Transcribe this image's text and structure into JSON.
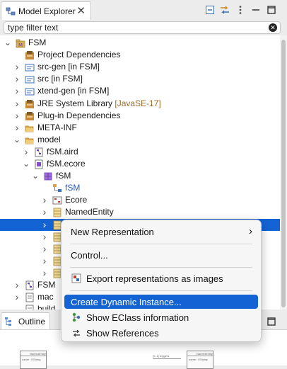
{
  "view": {
    "title": "Model Explorer",
    "close_glyph": "✕",
    "toolbar_icons": [
      "collapse-all-icon",
      "link-with-editor-icon",
      "view-menu-icon",
      "minimize-icon",
      "maximize-icon"
    ]
  },
  "filter": {
    "placeholder": "type filter text",
    "value": "type filter text"
  },
  "tree": [
    {
      "label": "FSM",
      "icon": "project-icon",
      "twisty": "expanded"
    },
    {
      "label": "Project Dependencies",
      "icon": "jar-library-icon",
      "twisty": "none"
    },
    {
      "label": "src-gen [in FSM]",
      "icon": "source-folder-icon",
      "twisty": "collapsed"
    },
    {
      "label": "src [in FSM]",
      "icon": "source-folder-icon",
      "twisty": "collapsed"
    },
    {
      "label": "xtend-gen [in FSM]",
      "icon": "source-folder-icon",
      "twisty": "collapsed"
    },
    {
      "label": "JRE System Library",
      "decoration": "[JavaSE-17]",
      "icon": "jar-library-icon",
      "twisty": "collapsed"
    },
    {
      "label": "Plug-in Dependencies",
      "icon": "jar-library-icon",
      "twisty": "collapsed"
    },
    {
      "label": "META-INF",
      "icon": "folder-open-icon",
      "twisty": "collapsed"
    },
    {
      "label": "model",
      "icon": "folder-open-icon",
      "twisty": "expanded"
    },
    {
      "label": "fSM.aird",
      "icon": "aird-file-icon",
      "twisty": "collapsed"
    },
    {
      "label": "fSM.ecore",
      "icon": "ecore-file-icon",
      "twisty": "expanded"
    },
    {
      "label": "fSM",
      "icon": "epackage-icon",
      "twisty": "expanded"
    },
    {
      "label": "fSM",
      "icon": "representation-icon",
      "twisty": "none",
      "style": "link"
    },
    {
      "label": "Ecore",
      "icon": "ecore-diagram-icon",
      "twisty": "collapsed"
    },
    {
      "label": "NamedEntity",
      "icon": "eclass-icon",
      "twisty": "collapsed"
    },
    {
      "label": "",
      "icon": "eclass-icon",
      "twisty": "collapsed",
      "selected": true
    },
    {
      "label": "",
      "icon": "eclass-icon",
      "twisty": "collapsed"
    },
    {
      "label": "",
      "icon": "eclass-icon",
      "twisty": "collapsed"
    },
    {
      "label": "",
      "icon": "eclass-icon",
      "twisty": "collapsed"
    },
    {
      "label": "",
      "icon": "eclass-icon",
      "twisty": "collapsed"
    },
    {
      "label": "FSM",
      "icon": "aird-file-icon",
      "twisty": "collapsed"
    },
    {
      "label": "mac",
      "icon": "file-icon",
      "twisty": "collapsed"
    },
    {
      "label": "build",
      "icon": "file-icon",
      "twisty": "none"
    }
  ],
  "outline": {
    "title": "Outline"
  },
  "outline_preview": {
    "node_a": "NamedEntity",
    "node_a_attr": "name : EString",
    "node_b": "NamedEntity",
    "node_b_attr": "name : EString",
    "edge": "[0..1] triggers"
  },
  "context_menu": {
    "items": [
      {
        "label": "New Representation",
        "submenu": true
      },
      {
        "separator": true
      },
      {
        "label": "Control..."
      },
      {
        "separator": true
      },
      {
        "label": "Export representations as images",
        "icon": "export-image-icon"
      },
      {
        "separator": true
      },
      {
        "label": "Create Dynamic Instance...",
        "highlighted": true
      },
      {
        "label": "Show EClass information",
        "icon": "eclass-info-icon"
      },
      {
        "label": "Show References",
        "icon": "references-icon"
      }
    ],
    "submenu_glyph": "›"
  },
  "colors": {
    "selection": "#1463d4",
    "link": "#2a5bb8",
    "decoration": "#9a6b2f"
  }
}
